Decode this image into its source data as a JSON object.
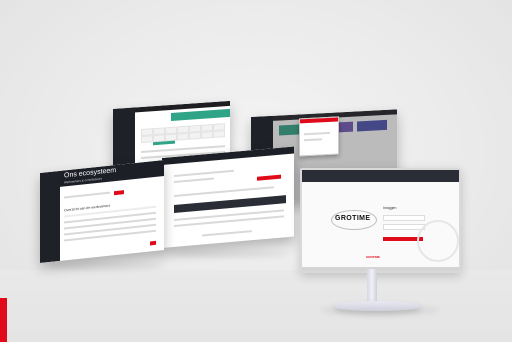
{
  "scene": {
    "kind": "product-mockup",
    "accent_colors": {
      "red": "#e10a1b",
      "teal": "#2fa486",
      "dark": "#1d1f27"
    }
  },
  "screen_calendar": {
    "date_heading": "",
    "toolbar_text": ""
  },
  "screen_employees": {
    "page_title": "Ons ecosysteem",
    "section_title": "Werknemers & contributeurs",
    "list_heading": "Overzicht van de werknemers"
  },
  "monitor": {
    "logo": "GROTIME",
    "login_title": "Inloggen",
    "brand": "GROTIME"
  }
}
